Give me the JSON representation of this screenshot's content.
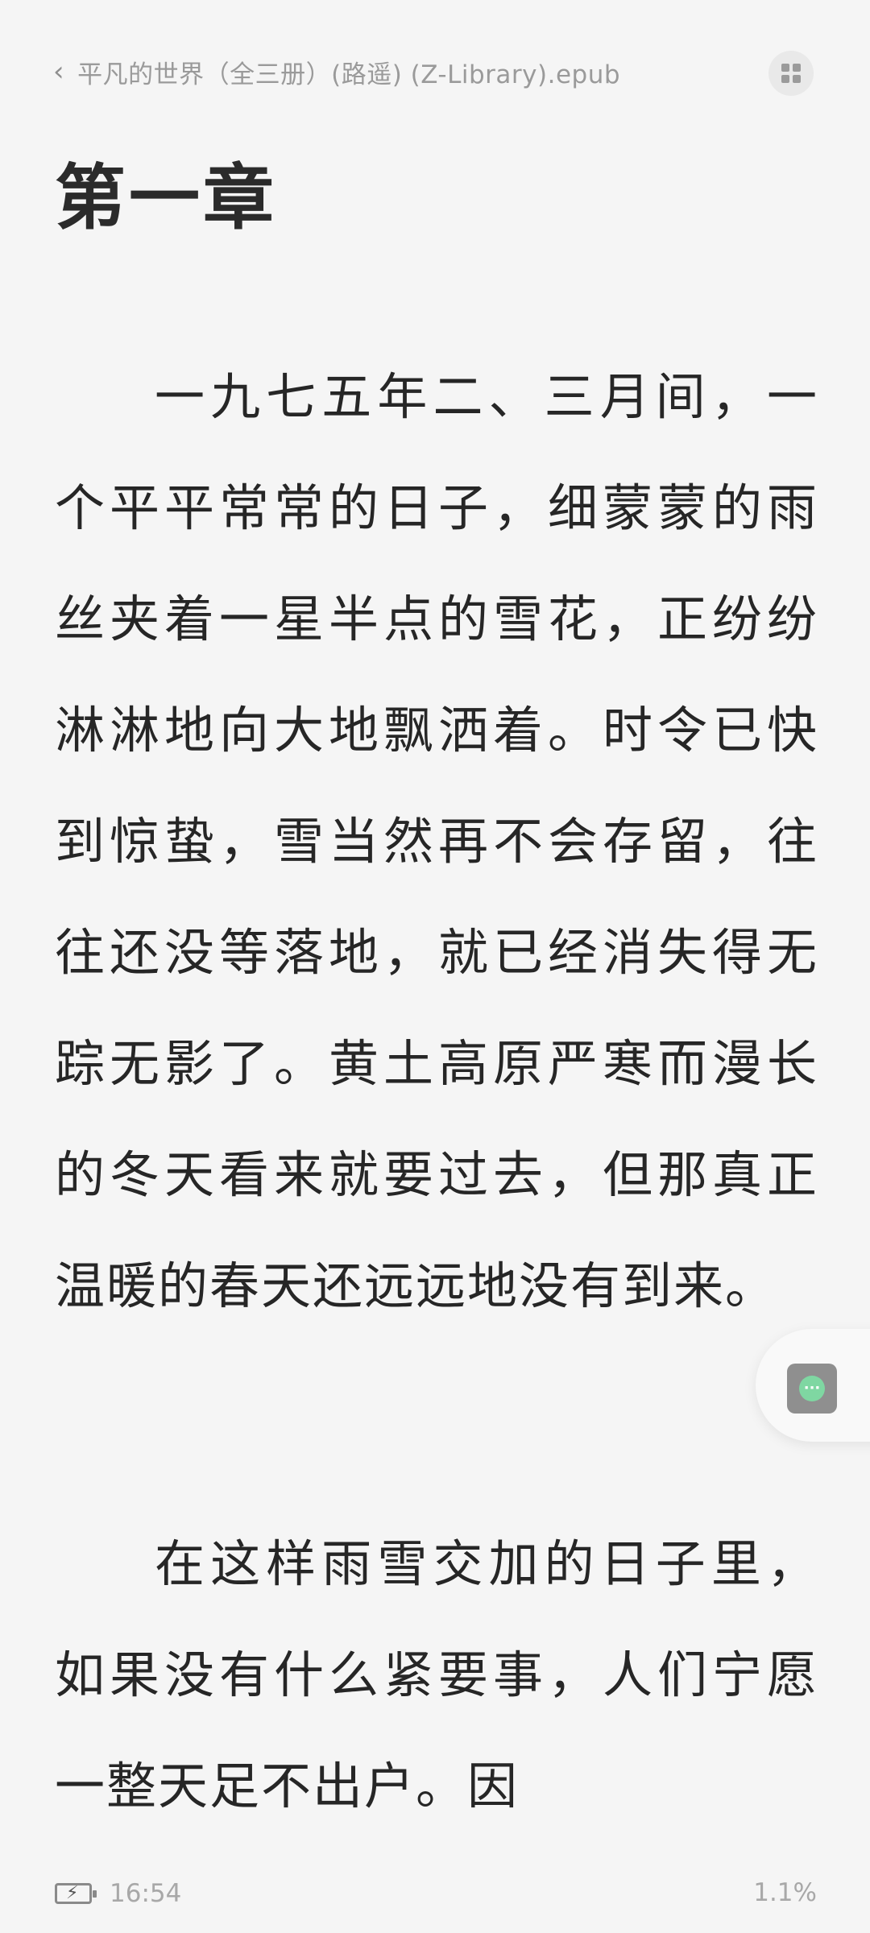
{
  "header": {
    "book_title": "平凡的世界（全三册）(路遥) (Z-Library).epub"
  },
  "chapter": {
    "title": "第一章"
  },
  "content": {
    "paragraphs": [
      "一九七五年二、三月间，一个平平常常的日子，细蒙蒙的雨丝夹着一星半点的雪花，正纷纷淋淋地向大地飘洒着。时令已快到惊蛰，雪当然再不会存留，往往还没等落地，就已经消失得无踪无影了。黄土高原严寒而漫长的冬天看来就要过去，但那真正温暖的春天还远远地没有到来。",
      "在这样雨雪交加的日子里，如果没有什么紧要事，人们宁愿一整天足不出户。因"
    ]
  },
  "status": {
    "time": "16:54",
    "progress": "1.1%"
  },
  "icons": {
    "back": "chevron-left-icon",
    "menu": "grid-icon",
    "assistant": "chat-bubble-icon",
    "battery": "battery-charging-icon"
  },
  "colors": {
    "background": "#f5f5f5",
    "text": "#262626",
    "muted": "#9a9a9a",
    "assistant_accent": "#7fd7a2"
  }
}
